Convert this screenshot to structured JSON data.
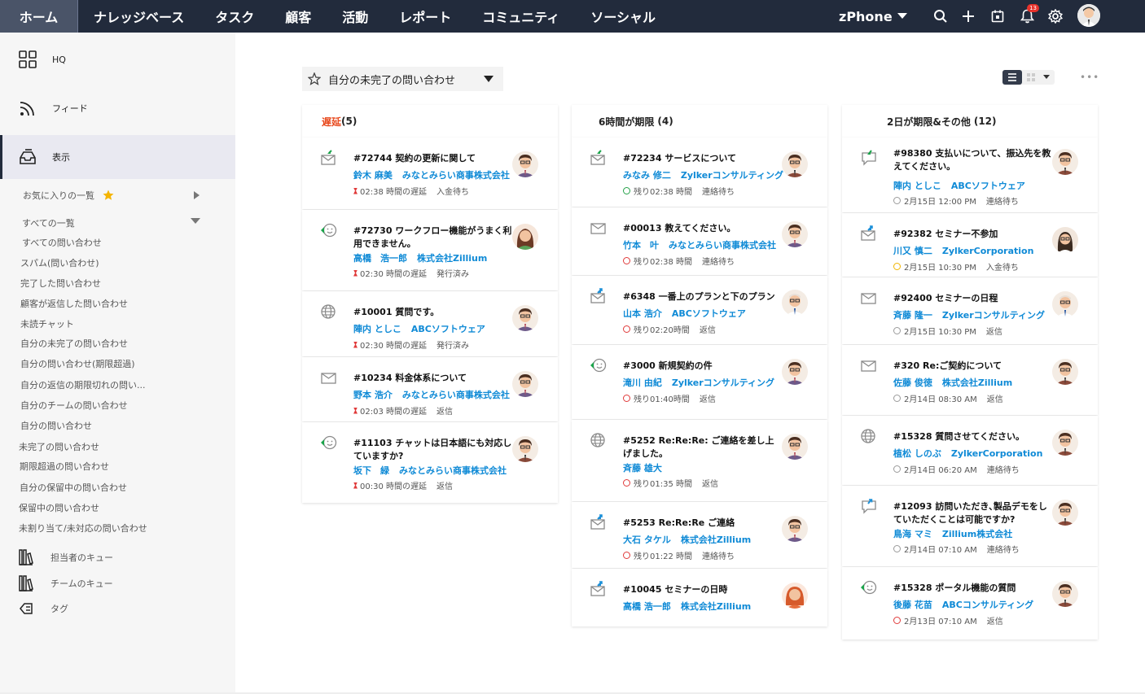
{
  "topnav": {
    "items": [
      "ホーム",
      "ナレッジベース",
      "タスク",
      "顧客",
      "活動",
      "レポート",
      "コミュニティ",
      "ソーシャル"
    ],
    "brand": "zPhone",
    "notification_count": "13"
  },
  "sidebar": {
    "main_items": [
      {
        "label": "HQ",
        "icon": "grid-icon"
      },
      {
        "label": "フィード",
        "icon": "feed-icon"
      },
      {
        "label": "表示",
        "icon": "inbox-icon"
      }
    ],
    "favorites_label": "お気に入りの一覧",
    "all_views_label": "すべての一覧",
    "views": [
      "すべての問い合わせ",
      "スパム(問い合わせ)",
      "完了した問い合わせ",
      "顧客が返信した問い合わせ",
      "未読チャット",
      "自分の未完了の問い合わせ",
      "自分の問い合わせ(期限超過)",
      "自分の返信の期限切れの問い...",
      "自分のチームの問い合わせ",
      "自分の問い合わせ",
      "未完了の問い合わせ",
      "期限超過の問い合わせ",
      "自分の保留中の問い合わせ",
      "保留中の問い合わせ",
      "未割り当て/未対応の問い合わせ"
    ],
    "sub_items": [
      "担当者のキュー",
      "チームのキュー",
      "タグ"
    ]
  },
  "main": {
    "view_selector": "自分の未完了の問い合わせ",
    "columns": [
      {
        "title": "遅延",
        "count": "(5)",
        "title_color": "#e8491d",
        "cards": [
          {
            "title": "#72744 契約の更新に関して",
            "contact": "鈴木 麻美",
            "account": "みなとみらい商事株式会社",
            "time": "02:38 時間の遅延",
            "status": "入金待ち",
            "channel": "email-in-icon",
            "avatar": "man-1"
          },
          {
            "title": "#72730 ワークフロー機能がうまく利用できません。",
            "contact": "高橋　浩一郎",
            "account": "株式会社Zillium",
            "time": "02:30 時間の遅延",
            "status": "発行済み",
            "channel": "chat-icon",
            "avatar": "woman-1"
          },
          {
            "title": "#10001 質問です。",
            "contact": "陣内 としこ",
            "account": "ABCソフトウェア",
            "time": "02:30 時間の遅延",
            "status": "発行済み",
            "channel": "web-icon",
            "avatar": "man-1"
          },
          {
            "title": "#10234 料金体系について",
            "contact": "野本 浩介",
            "account": "みなとみらい商事株式会社",
            "time": "02:03 時間の遅延",
            "status": "返信",
            "channel": "email-icon",
            "avatar": "man-1"
          },
          {
            "title": "#11103 チャットは日本語にも対応していますか?",
            "contact": "坂下　緑",
            "account": "みなとみらい商事株式会社",
            "time": "00:30 時間の遅延",
            "status": "返信",
            "channel": "chat-icon",
            "avatar": "man-2"
          }
        ]
      },
      {
        "title": "6時間が期限",
        "count": "(4)",
        "title_color": "#222222",
        "cards": [
          {
            "title": "#72234 サービスについて",
            "contact": "みなみ 修二",
            "account": "Zylkerコンサルティング",
            "time": "残り02:38 時間",
            "status": "連絡待ち",
            "channel": "email-in-icon",
            "avatar": "man-2",
            "clock": "green"
          },
          {
            "title": "#00013 教えてください。",
            "contact": "竹本　叶",
            "account": "みなとみらい商事株式会社",
            "time": "残り02:38 時間",
            "status": "連絡待ち",
            "channel": "email-icon",
            "avatar": "man-1",
            "clock": "red"
          },
          {
            "title": "#6348 一番上のプランと下のプラン",
            "contact": "山本 浩介",
            "account": "ABCソフトウェア",
            "time": "残り02:20時間",
            "status": "返信",
            "channel": "email-out-icon",
            "avatar": "man-3",
            "clock": "red"
          },
          {
            "title": "#3000 新規契約の件",
            "contact": "滝川 由紀",
            "account": "Zylkerコンサルティング",
            "time": "残り01:40時間",
            "status": "返信",
            "channel": "chat-icon",
            "avatar": "man-1",
            "clock": "red"
          },
          {
            "title": "#5252 Re:Re:Re: ご連絡を差し上げました。",
            "contact": "斉藤 雄大",
            "account": "",
            "time": "残り01:35 時間",
            "status": "返信",
            "channel": "web-icon",
            "avatar": "man-1",
            "clock": "red"
          },
          {
            "title": "#5253 Re:Re:Re ご連絡",
            "contact": "大石 タケル",
            "account": "株式会社Zillium",
            "time": "残り01:22 時間",
            "status": "連絡待ち",
            "channel": "email-out-icon",
            "avatar": "man-1",
            "clock": "red"
          },
          {
            "title": "#10045 セミナーの日時",
            "contact": "高橋 浩一郎",
            "account": "株式会社Zillium",
            "time": "",
            "status": "",
            "channel": "email-out-icon",
            "avatar": "woman-2",
            "clock": ""
          }
        ]
      },
      {
        "title": "2日が期限&その他",
        "count": "(12)",
        "title_color": "#222222",
        "cards": [
          {
            "title": "#98380 支払いについて、振込先を教えてください。",
            "contact": "陣内 としこ",
            "account": "ABCソフトウェア",
            "time": "2月15日 12:00 PM",
            "status": "連絡待ち",
            "channel": "chat-in-icon",
            "avatar": "man-2",
            "clock": "gray"
          },
          {
            "title": "#92382 セミナー不参加",
            "contact": "川又 慎二",
            "account": "ZylkerCorporation",
            "time": "2月15日 10:30 PM",
            "status": "入金待ち",
            "channel": "email-out-icon",
            "avatar": "woman-3",
            "clock": "yellow"
          },
          {
            "title": "#92400 セミナーの日程",
            "contact": "斉藤 隆一",
            "account": "Zylkerコンサルティング",
            "time": "2月15日 10:30 PM",
            "status": "返信",
            "channel": "email-icon",
            "avatar": "man-3",
            "clock": "gray"
          },
          {
            "title": "#320 Re:ご契約について",
            "contact": "佐藤 俊徳",
            "account": "株式会社Zillium",
            "time": "2月14日 08:30 AM",
            "status": "返信",
            "channel": "email-icon",
            "avatar": "man-2",
            "clock": "gray"
          },
          {
            "title": "#15328 質問させてください。",
            "contact": "植松 しのぶ",
            "account": "ZylkerCorporation",
            "time": "2月14日 06:20 AM",
            "status": "連絡待ち",
            "channel": "web-icon",
            "avatar": "man-2",
            "clock": "gray"
          },
          {
            "title": "#12093 訪問いただき､製品デモをしていただくことは可能ですか?",
            "contact": "鳥海 マミ",
            "account": "Zillium株式会社",
            "time": "2月14日 07:10 AM",
            "status": "連絡待ち",
            "channel": "chat-out-icon",
            "avatar": "man-2",
            "clock": "gray"
          },
          {
            "title": "#15328 ポータル機能の質問",
            "contact": "後藤 花苗",
            "account": "ABCコンサルティング",
            "time": "2月13日 07:10 AM",
            "status": "返信",
            "channel": "chat-icon",
            "avatar": "man-2",
            "clock": "red"
          }
        ]
      }
    ]
  }
}
